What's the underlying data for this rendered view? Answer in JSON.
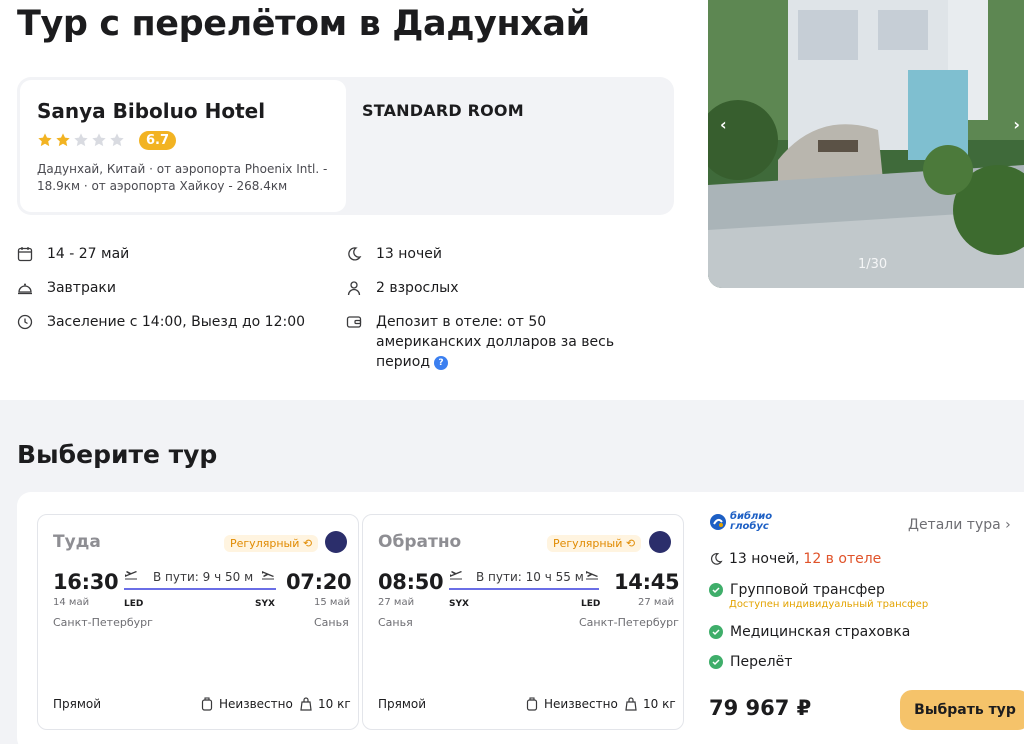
{
  "page": {
    "title": "Тур с перелётом в Дадунхай"
  },
  "hotel": {
    "name": "Sanya Biboluo Hotel",
    "stars": 2,
    "stars_max": 5,
    "rating": "6.7",
    "location": "Дадунхай, Китай · от аэропорта Phoenix Intl. - 18.9км · от аэропорта Хайкоу - 268.4км",
    "room_type": "STANDARD ROOM",
    "photo_counter": "1/30"
  },
  "trip_info": {
    "dates": "14 - 27 май",
    "meals": "Завтраки",
    "checkin": "Заселение с 14:00, Выезд до 12:00",
    "nights": "13 ночей",
    "guests": "2 взрослых",
    "deposit": "Депозит в отеле: от 50 американских долларов за весь период"
  },
  "tour_section": {
    "title": "Выберите тур"
  },
  "flights": {
    "outbound": {
      "direction": "Туда",
      "badge": "Регулярный",
      "dep_time": "16:30",
      "dep_date": "14 май",
      "dep_city": "Санкт-Петербург",
      "dep_code": "LED",
      "duration": "В пути: 9 ч 50 м",
      "arr_time": "07:20",
      "arr_date": "15 май",
      "arr_city": "Санья",
      "arr_code": "SYX",
      "type": "Прямой",
      "baggage": "Неизвестно",
      "hand_luggage": "10 кг"
    },
    "return": {
      "direction": "Обратно",
      "badge": "Регулярный",
      "dep_time": "08:50",
      "dep_date": "27 май",
      "dep_city": "Санья",
      "dep_code": "SYX",
      "duration": "В пути: 10 ч 55 м",
      "arr_time": "14:45",
      "arr_date": "27 май",
      "arr_city": "Санкт-Петербург",
      "arr_code": "LED",
      "type": "Прямой",
      "baggage": "Неизвестно",
      "hand_luggage": "10 кг"
    }
  },
  "offer": {
    "operator_logo_line1": "библио",
    "operator_logo_line2": "глобус",
    "details_link": "Детали тура",
    "nights": "13 ночей,",
    "nights_in_hotel": "12 в отеле",
    "features": [
      "Групповой трансфер",
      "Медицинская страховка",
      "Перелёт"
    ],
    "transfer_note": "Доступен индивидуальный трансфер",
    "price": "79 967 ₽",
    "choose_button": "Выбрать тур"
  },
  "colors": {
    "accent_blue": "#6a6ee6",
    "badge_orange": "#e08a00",
    "rating_yellow": "#f2b322",
    "check_green": "#3fae6a",
    "button_yellow": "#f5c36a",
    "in_hotel_red": "#e0532a"
  }
}
